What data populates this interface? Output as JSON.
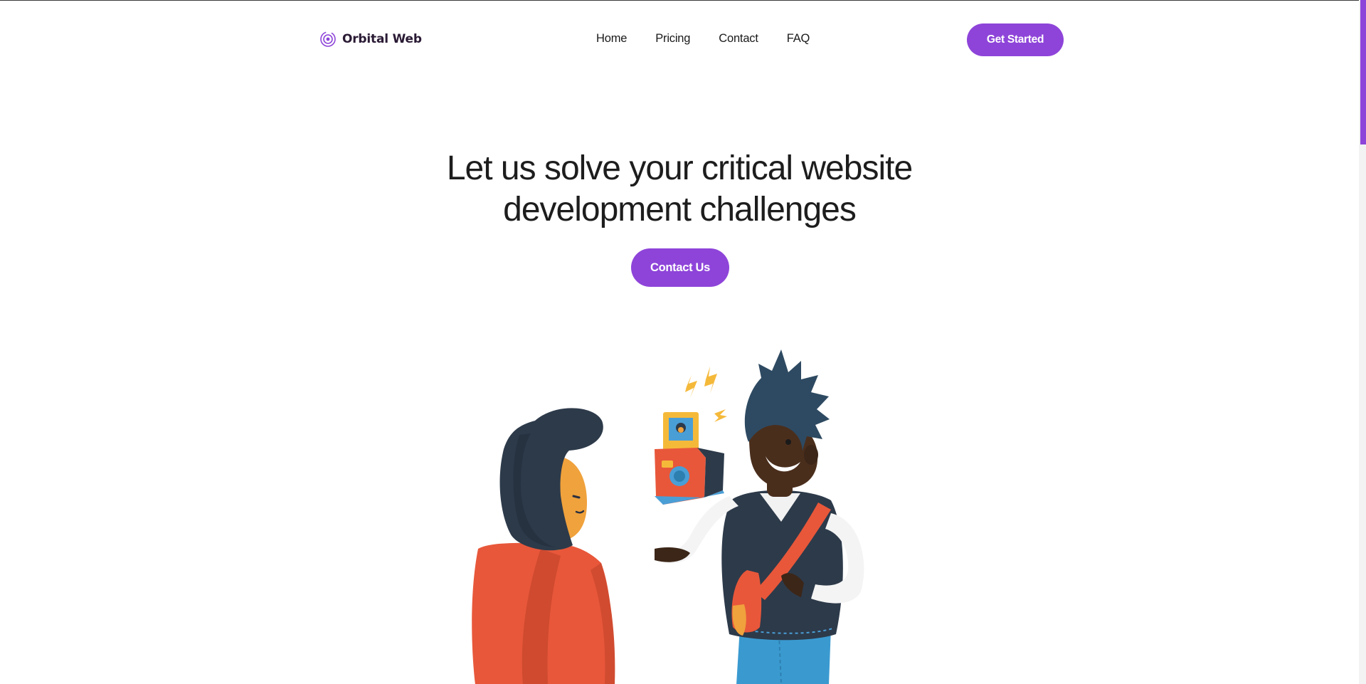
{
  "brand": {
    "name": "Orbital Web",
    "icon": "orbit-target-icon"
  },
  "nav": {
    "links": [
      "Home",
      "Pricing",
      "Contact",
      "FAQ"
    ],
    "cta_label": "Get Started"
  },
  "hero": {
    "title_line_1": "Let us solve your critical website",
    "title_line_2": "development challenges",
    "cta_label": "Contact Us",
    "illustration": "two-people-with-instant-camera-illustration"
  },
  "colors": {
    "accent": "#8e44d9",
    "text": "#1d1d1d",
    "brand_text": "#2a1a34"
  }
}
